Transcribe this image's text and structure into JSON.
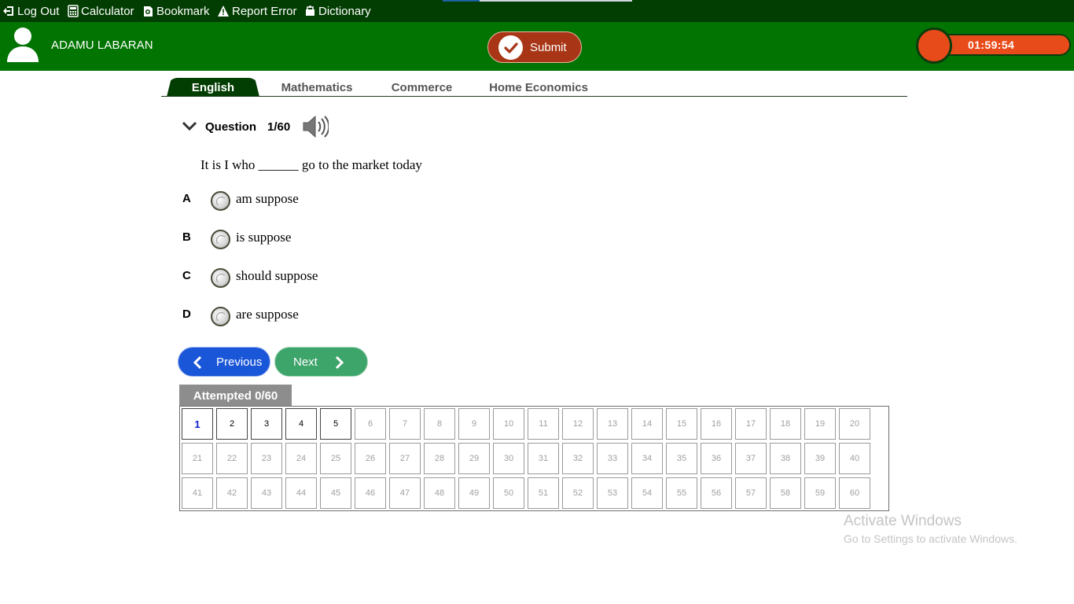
{
  "toolbar": {
    "logout": "Log Out",
    "calculator": "Calculator",
    "bookmark": "Bookmark",
    "report_error": "Report Error",
    "dictionary": "Dictionary"
  },
  "header": {
    "username": "ADAMU LABARAN",
    "submit_label": "Submit",
    "timer": "01:59:54"
  },
  "tabs": [
    {
      "label": "English",
      "active": true
    },
    {
      "label": "Mathematics",
      "active": false
    },
    {
      "label": "Commerce",
      "active": false
    },
    {
      "label": "Home Economics",
      "active": false
    }
  ],
  "question": {
    "label": "Question",
    "number": "1/60",
    "text": "It is I who ______ go to the market today",
    "options": [
      {
        "letter": "A",
        "text": "am suppose"
      },
      {
        "letter": "B",
        "text": "is suppose"
      },
      {
        "letter": "C",
        "text": "should suppose"
      },
      {
        "letter": "D",
        "text": "are suppose"
      }
    ]
  },
  "navigation": {
    "previous": "Previous",
    "next": "Next"
  },
  "attempted": {
    "label": "Attempted 0/60",
    "current_question": 1,
    "visited_questions": [
      1,
      2,
      3,
      4,
      5
    ],
    "total": 60
  },
  "watermark": {
    "title": "Activate Windows",
    "subtitle": "Go to Settings to activate Windows."
  },
  "colors": {
    "toolbar_bg": "#023d02",
    "header_bg": "#027402",
    "submit_bg": "#a83616",
    "timer_bg": "#e84b1a",
    "previous_bg": "#1a56d8",
    "next_bg": "#3da46a"
  }
}
